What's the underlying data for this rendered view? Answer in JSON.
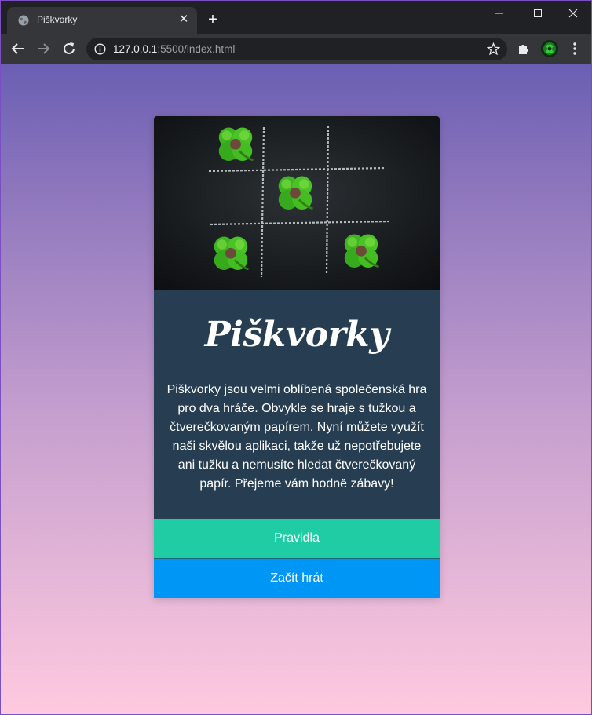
{
  "browser": {
    "tab_title": "Piškvorky",
    "tab_close": "✕",
    "new_tab": "+",
    "url_host": "127.0.0.1",
    "url_rest": ":5500/index.html"
  },
  "colors": {
    "gradient_top": "#6a5fb3",
    "gradient_bottom": "#ffcadf",
    "card_body": "#263d52",
    "rules_button": "#1fcca4",
    "play_button": "#0096f5"
  },
  "hero_image": {
    "description_icon": "tic-tac-toe-chalk-board-with-four-leaf-clovers"
  },
  "card": {
    "title": "Piškvorky",
    "text": "Piškvorky jsou velmi oblíbená společenská hra pro dva hráče. Obvykle se hraje s tužkou a čtverečkovaným papírem. Nyní můžete využít naši skvělou aplikaci, takže už nepotřebujete ani tužku a nemusíte hledat čtverečkovaný papír. Přejeme vám hodně zábavy!",
    "rules_button": "Pravidla",
    "play_button": "Začít hrát"
  }
}
